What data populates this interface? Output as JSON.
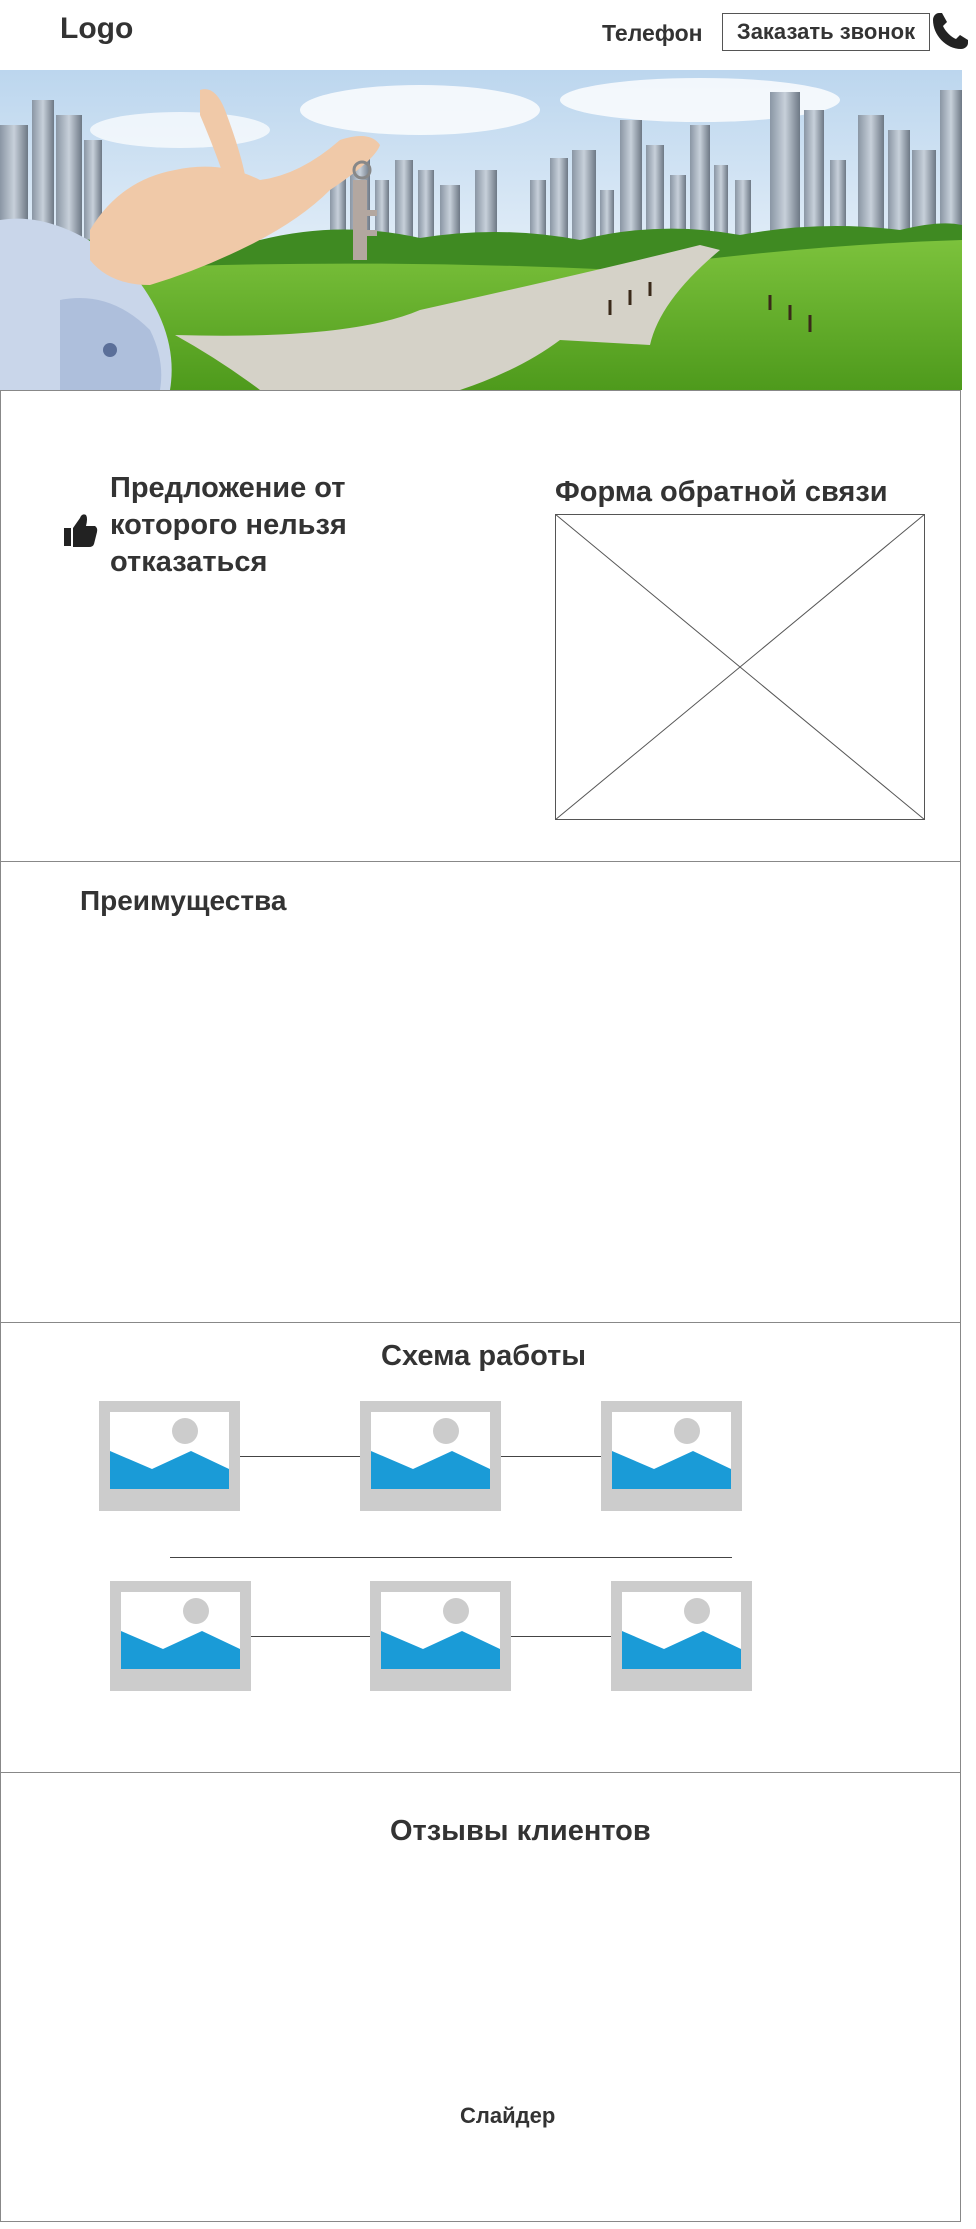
{
  "header": {
    "logo": "Logo",
    "phone_label": "Телефон",
    "callback_button": "Заказать звонок",
    "phone_icon": "phone-icon"
  },
  "offer": {
    "icon": "thumbs-up-icon",
    "text": "Предложение от которого нельзя отказаться"
  },
  "feedback_form": {
    "title": "Форма обратной связи"
  },
  "advantages": {
    "title": "Преимущества"
  },
  "work_scheme": {
    "title": "Схема работы",
    "steps": 6,
    "placeholder_colors": {
      "frame": "#cccccc",
      "sky": "#ffffff",
      "mountain": "#1a9bd7",
      "sun": "#cccccc"
    }
  },
  "reviews": {
    "title": "Отзывы клиентов",
    "slider_label": "Слайдер"
  }
}
